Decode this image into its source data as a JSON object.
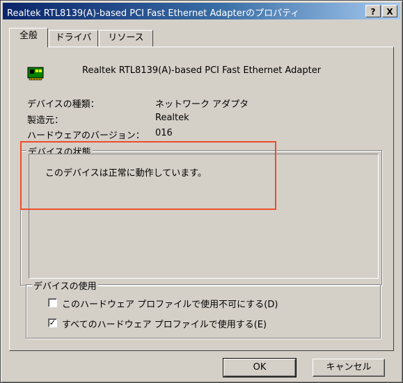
{
  "window": {
    "title": "Realtek RTL8139(A)-based PCI Fast Ethernet Adapterのプロパティ",
    "help_button": "?",
    "close_button": "X"
  },
  "tabs": [
    {
      "label": "全般",
      "active": true
    },
    {
      "label": "ドライバ",
      "active": false
    },
    {
      "label": "リソース",
      "active": false
    }
  ],
  "device": {
    "icon": "network-adapter-icon",
    "name": "Realtek RTL8139(A)-based PCI Fast Ethernet Adapter",
    "type_label": "デバイスの種類：",
    "type_value": "ネットワーク アダプタ",
    "maker_label": "製造元：",
    "maker_value": "Realtek",
    "hw_version_label": "ハードウェアのバージョン：",
    "hw_version_value": "016"
  },
  "status_group": {
    "label": "デバイスの状態",
    "text": "このデバイスは正常に動作しています。"
  },
  "usage_group": {
    "label": "デバイスの使用",
    "option1": {
      "label": "このハードウェア プロファイルで使用不可にする(D)",
      "checked": false
    },
    "option2": {
      "label": "すべてのハードウェア プロファイルで使用する(E)",
      "checked": true
    }
  },
  "buttons": {
    "ok": "OK",
    "cancel": "キャンセル"
  },
  "colors": {
    "highlight": "#ef4b2b",
    "titlebar_start": "#0a246a",
    "face": "#d4d0c8"
  }
}
